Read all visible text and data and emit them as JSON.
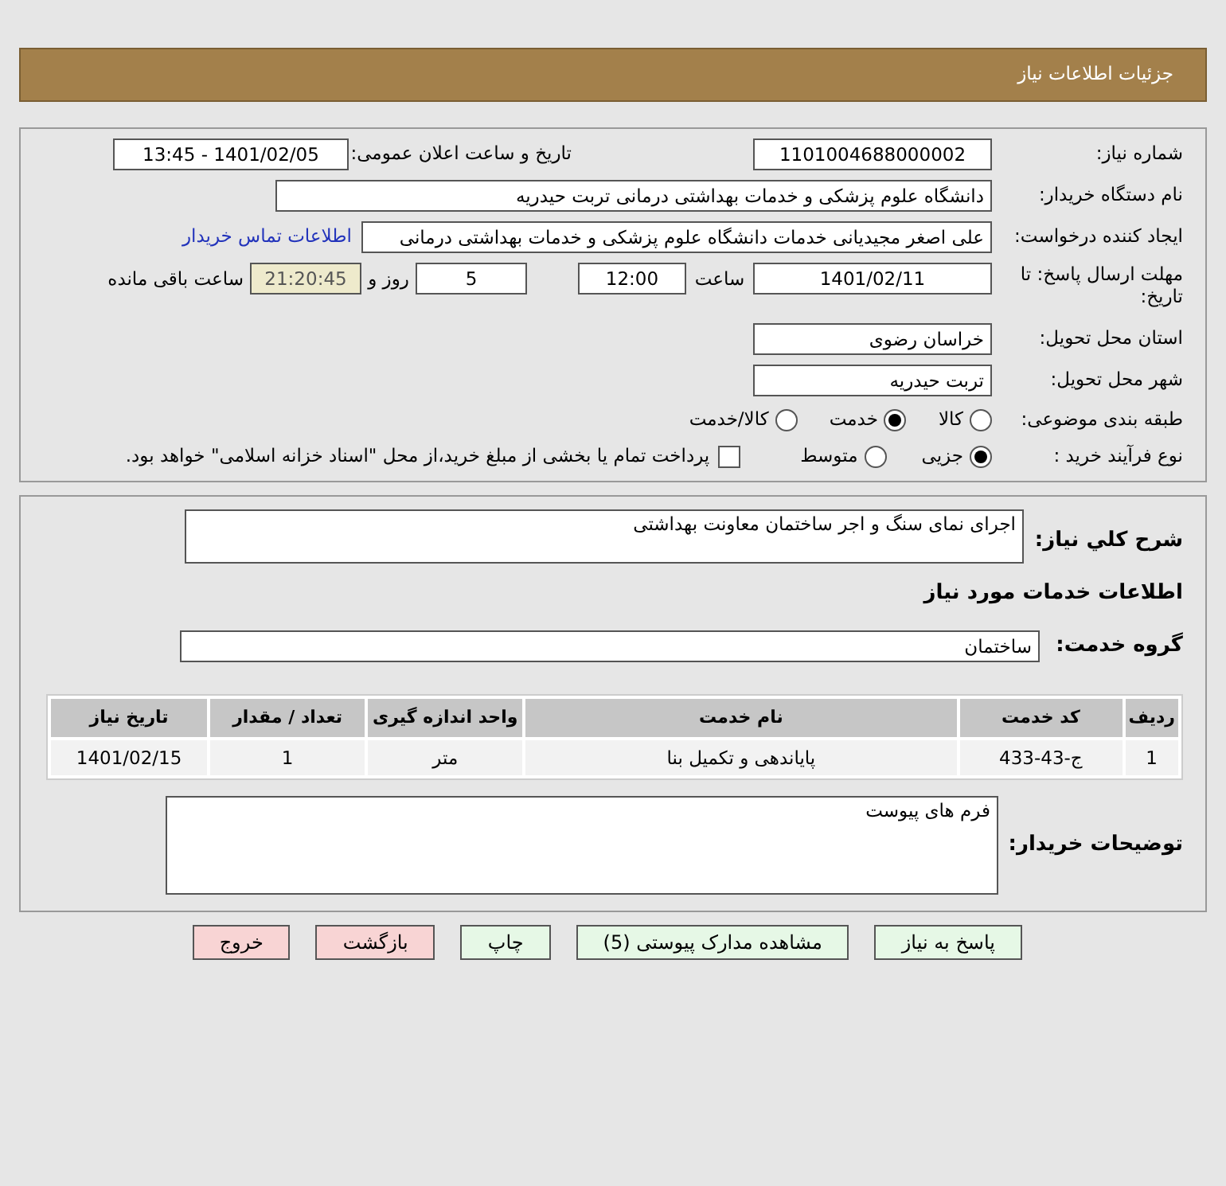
{
  "header": {
    "title": "جزئیات اطلاعات نیاز"
  },
  "details": {
    "need_number": {
      "label": "شماره نیاز:",
      "value": "1101004688000002"
    },
    "announce": {
      "label": "تاریخ و ساعت اعلان عمومی:",
      "value": "1401/02/05 - 13:45"
    },
    "buyer_org": {
      "label": "نام دستگاه خریدار:",
      "value": "دانشگاه علوم پزشکی و خدمات بهداشتی درمانی تربت حیدریه"
    },
    "requester": {
      "label": "ایجاد کننده درخواست:",
      "value": "علی اصغر مجیدیانی خدمات دانشگاه علوم پزشکی و خدمات بهداشتی درمانی",
      "link": "اطلاعات تماس خریدار"
    },
    "deadline": {
      "label": "مهلت ارسال پاسخ: تا تاریخ:",
      "date": "1401/02/11",
      "time_label": "ساعت",
      "time": "12:00",
      "days": "5",
      "days_label": "روز و",
      "remaining": "21:20:45",
      "remaining_label": "ساعت باقی مانده"
    },
    "province": {
      "label": "استان محل تحویل:",
      "value": "خراسان رضوی"
    },
    "city": {
      "label": "شهر محل تحویل:",
      "value": "تربت حیدریه"
    },
    "category": {
      "label": "طبقه بندی موضوعی:",
      "options": [
        {
          "label": "کالا",
          "selected": false
        },
        {
          "label": "خدمت",
          "selected": true
        },
        {
          "label": "کالا/خدمت",
          "selected": false
        }
      ]
    },
    "process": {
      "label": "نوع فرآیند خرید :",
      "options": [
        {
          "label": "جزیی",
          "selected": true
        },
        {
          "label": "متوسط",
          "selected": false
        }
      ],
      "payment": {
        "label": "پرداخت تمام یا بخشی از مبلغ خرید،از محل \"اسناد خزانه اسلامی\" خواهد بود.",
        "checked": false
      }
    }
  },
  "need": {
    "description": {
      "label": "شرح کلي نياز:",
      "value": "اجرای نمای سنگ و اجر ساختمان معاونت بهداشتی"
    },
    "services_title": "اطلاعات خدمات مورد نیاز",
    "service_group": {
      "label": "گروه خدمت:",
      "value": "ساختمان"
    },
    "table": {
      "columns": [
        "ردیف",
        "کد خدمت",
        "نام خدمت",
        "واحد اندازه گیری",
        "تعداد / مقدار",
        "تاریخ نیاز"
      ],
      "rows": [
        [
          "1",
          "ج-43-433",
          "پاياندهی و تكميل بنا",
          "متر",
          "1",
          "1401/02/15"
        ]
      ]
    },
    "buyer_notes": {
      "label": "توضیحات خریدار:",
      "value": "فرم های پیوست"
    }
  },
  "buttons": [
    {
      "label": "پاسخ به نیاز",
      "kind": "normal"
    },
    {
      "label": "مشاهده مدارک پیوستی (5)",
      "kind": "normal"
    },
    {
      "label": "چاپ",
      "kind": "normal"
    },
    {
      "label": "بازگشت",
      "kind": "danger"
    },
    {
      "label": "خروج",
      "kind": "danger"
    }
  ]
}
